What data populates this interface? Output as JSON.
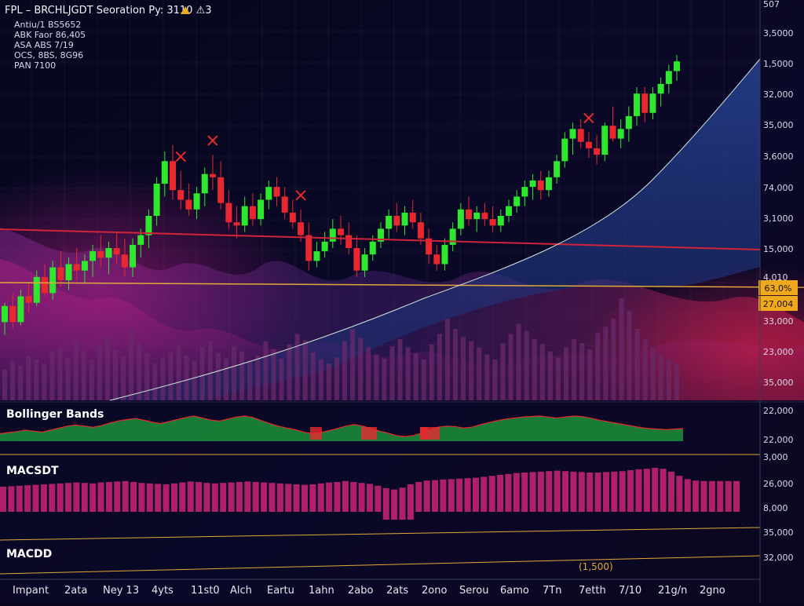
{
  "header": {
    "title": "FPL – BRCHLJGDT Seoration Py: 3110 ⚠3",
    "warning_icon": "warning-icon",
    "indicators": [
      "Antiu/1 BS5652",
      "ABK Faor 86,405",
      "ASA ABS 7/19",
      "OCS, 8BS, 8G96",
      "PAN 7100"
    ]
  },
  "colors": {
    "background": "#07061c",
    "bull": "#2ee82e",
    "bear": "#e8282e",
    "resistance": "#d0243a",
    "support": "#e0a93a",
    "trend": "#cfe8d8",
    "price_badge": "#f0a81c",
    "marker": "#e82a2a",
    "volume": "#6a2a6a",
    "bollinger": "#1a8a3a",
    "macd": "#b0206a"
  },
  "price_badges": [
    "63,0%",
    "27,004"
  ],
  "chart_data": [
    {
      "type": "candlestick",
      "panel": "price",
      "y_tick_labels": [
        "507",
        "3,5000",
        "1,5000",
        "32,000",
        "35,000",
        "3,6000",
        "74,000",
        "3,1000",
        "15,000",
        "4,010",
        "33,000",
        "23,000",
        "35,000"
      ],
      "candles": [
        {
          "o": 0.17,
          "h": 0.23,
          "l": 0.13,
          "c": 0.22
        },
        {
          "o": 0.22,
          "h": 0.26,
          "l": 0.15,
          "c": 0.17
        },
        {
          "o": 0.17,
          "h": 0.27,
          "l": 0.16,
          "c": 0.25
        },
        {
          "o": 0.25,
          "h": 0.29,
          "l": 0.2,
          "c": 0.23
        },
        {
          "o": 0.23,
          "h": 0.33,
          "l": 0.22,
          "c": 0.31
        },
        {
          "o": 0.31,
          "h": 0.35,
          "l": 0.25,
          "c": 0.26
        },
        {
          "o": 0.26,
          "h": 0.36,
          "l": 0.24,
          "c": 0.34
        },
        {
          "o": 0.34,
          "h": 0.39,
          "l": 0.28,
          "c": 0.3
        },
        {
          "o": 0.3,
          "h": 0.37,
          "l": 0.27,
          "c": 0.35
        },
        {
          "o": 0.35,
          "h": 0.4,
          "l": 0.3,
          "c": 0.33
        },
        {
          "o": 0.33,
          "h": 0.38,
          "l": 0.29,
          "c": 0.36
        },
        {
          "o": 0.36,
          "h": 0.41,
          "l": 0.31,
          "c": 0.39
        },
        {
          "o": 0.39,
          "h": 0.44,
          "l": 0.34,
          "c": 0.37
        },
        {
          "o": 0.37,
          "h": 0.42,
          "l": 0.32,
          "c": 0.4
        },
        {
          "o": 0.4,
          "h": 0.45,
          "l": 0.35,
          "c": 0.38
        },
        {
          "o": 0.38,
          "h": 0.43,
          "l": 0.31,
          "c": 0.34
        },
        {
          "o": 0.34,
          "h": 0.43,
          "l": 0.31,
          "c": 0.41
        },
        {
          "o": 0.41,
          "h": 0.46,
          "l": 0.37,
          "c": 0.44
        },
        {
          "o": 0.44,
          "h": 0.52,
          "l": 0.4,
          "c": 0.5
        },
        {
          "o": 0.5,
          "h": 0.62,
          "l": 0.47,
          "c": 0.6
        },
        {
          "o": 0.6,
          "h": 0.7,
          "l": 0.56,
          "c": 0.67
        },
        {
          "o": 0.67,
          "h": 0.72,
          "l": 0.55,
          "c": 0.58
        },
        {
          "o": 0.58,
          "h": 0.64,
          "l": 0.52,
          "c": 0.55
        },
        {
          "o": 0.55,
          "h": 0.6,
          "l": 0.5,
          "c": 0.52
        },
        {
          "o": 0.52,
          "h": 0.59,
          "l": 0.49,
          "c": 0.57
        },
        {
          "o": 0.57,
          "h": 0.65,
          "l": 0.53,
          "c": 0.63
        },
        {
          "o": 0.63,
          "h": 0.69,
          "l": 0.58,
          "c": 0.62
        },
        {
          "o": 0.62,
          "h": 0.67,
          "l": 0.52,
          "c": 0.54
        },
        {
          "o": 0.54,
          "h": 0.58,
          "l": 0.46,
          "c": 0.48
        },
        {
          "o": 0.48,
          "h": 0.53,
          "l": 0.43,
          "c": 0.47
        },
        {
          "o": 0.47,
          "h": 0.56,
          "l": 0.45,
          "c": 0.53
        },
        {
          "o": 0.53,
          "h": 0.57,
          "l": 0.47,
          "c": 0.49
        },
        {
          "o": 0.49,
          "h": 0.57,
          "l": 0.47,
          "c": 0.55
        },
        {
          "o": 0.55,
          "h": 0.61,
          "l": 0.52,
          "c": 0.59
        },
        {
          "o": 0.59,
          "h": 0.62,
          "l": 0.53,
          "c": 0.56
        },
        {
          "o": 0.56,
          "h": 0.59,
          "l": 0.49,
          "c": 0.51
        },
        {
          "o": 0.51,
          "h": 0.55,
          "l": 0.46,
          "c": 0.48
        },
        {
          "o": 0.48,
          "h": 0.52,
          "l": 0.42,
          "c": 0.44
        },
        {
          "o": 0.44,
          "h": 0.48,
          "l": 0.33,
          "c": 0.36
        },
        {
          "o": 0.36,
          "h": 0.42,
          "l": 0.34,
          "c": 0.39
        },
        {
          "o": 0.39,
          "h": 0.45,
          "l": 0.37,
          "c": 0.42
        },
        {
          "o": 0.42,
          "h": 0.49,
          "l": 0.4,
          "c": 0.46
        },
        {
          "o": 0.46,
          "h": 0.5,
          "l": 0.41,
          "c": 0.44
        },
        {
          "o": 0.44,
          "h": 0.48,
          "l": 0.38,
          "c": 0.4
        },
        {
          "o": 0.4,
          "h": 0.44,
          "l": 0.31,
          "c": 0.33
        },
        {
          "o": 0.33,
          "h": 0.4,
          "l": 0.31,
          "c": 0.38
        },
        {
          "o": 0.38,
          "h": 0.44,
          "l": 0.36,
          "c": 0.42
        },
        {
          "o": 0.42,
          "h": 0.48,
          "l": 0.4,
          "c": 0.46
        },
        {
          "o": 0.46,
          "h": 0.52,
          "l": 0.43,
          "c": 0.5
        },
        {
          "o": 0.5,
          "h": 0.54,
          "l": 0.45,
          "c": 0.47
        },
        {
          "o": 0.47,
          "h": 0.53,
          "l": 0.44,
          "c": 0.51
        },
        {
          "o": 0.51,
          "h": 0.55,
          "l": 0.46,
          "c": 0.48
        },
        {
          "o": 0.48,
          "h": 0.51,
          "l": 0.41,
          "c": 0.43
        },
        {
          "o": 0.43,
          "h": 0.46,
          "l": 0.35,
          "c": 0.38
        },
        {
          "o": 0.38,
          "h": 0.41,
          "l": 0.33,
          "c": 0.35
        },
        {
          "o": 0.35,
          "h": 0.43,
          "l": 0.33,
          "c": 0.41
        },
        {
          "o": 0.41,
          "h": 0.48,
          "l": 0.39,
          "c": 0.46
        },
        {
          "o": 0.46,
          "h": 0.54,
          "l": 0.44,
          "c": 0.52
        },
        {
          "o": 0.52,
          "h": 0.56,
          "l": 0.47,
          "c": 0.49
        },
        {
          "o": 0.49,
          "h": 0.53,
          "l": 0.45,
          "c": 0.51
        },
        {
          "o": 0.51,
          "h": 0.54,
          "l": 0.47,
          "c": 0.49
        },
        {
          "o": 0.49,
          "h": 0.53,
          "l": 0.45,
          "c": 0.47
        },
        {
          "o": 0.47,
          "h": 0.52,
          "l": 0.45,
          "c": 0.5
        },
        {
          "o": 0.5,
          "h": 0.55,
          "l": 0.48,
          "c": 0.53
        },
        {
          "o": 0.53,
          "h": 0.58,
          "l": 0.51,
          "c": 0.56
        },
        {
          "o": 0.56,
          "h": 0.61,
          "l": 0.53,
          "c": 0.59
        },
        {
          "o": 0.59,
          "h": 0.63,
          "l": 0.55,
          "c": 0.61
        },
        {
          "o": 0.61,
          "h": 0.64,
          "l": 0.55,
          "c": 0.58
        },
        {
          "o": 0.58,
          "h": 0.64,
          "l": 0.56,
          "c": 0.62
        },
        {
          "o": 0.62,
          "h": 0.69,
          "l": 0.6,
          "c": 0.67
        },
        {
          "o": 0.67,
          "h": 0.76,
          "l": 0.65,
          "c": 0.74
        },
        {
          "o": 0.74,
          "h": 0.79,
          "l": 0.69,
          "c": 0.77
        },
        {
          "o": 0.77,
          "h": 0.8,
          "l": 0.71,
          "c": 0.73
        },
        {
          "o": 0.73,
          "h": 0.76,
          "l": 0.68,
          "c": 0.71
        },
        {
          "o": 0.71,
          "h": 0.75,
          "l": 0.66,
          "c": 0.69
        },
        {
          "o": 0.69,
          "h": 0.79,
          "l": 0.67,
          "c": 0.78
        },
        {
          "o": 0.78,
          "h": 0.84,
          "l": 0.73,
          "c": 0.74
        },
        {
          "o": 0.74,
          "h": 0.8,
          "l": 0.71,
          "c": 0.77
        },
        {
          "o": 0.77,
          "h": 0.84,
          "l": 0.73,
          "c": 0.81
        },
        {
          "o": 0.81,
          "h": 0.9,
          "l": 0.78,
          "c": 0.88
        },
        {
          "o": 0.88,
          "h": 0.9,
          "l": 0.79,
          "c": 0.82
        },
        {
          "o": 0.82,
          "h": 0.9,
          "l": 0.8,
          "c": 0.88
        },
        {
          "o": 0.88,
          "h": 0.93,
          "l": 0.84,
          "c": 0.91
        },
        {
          "o": 0.91,
          "h": 0.97,
          "l": 0.88,
          "c": 0.95
        },
        {
          "o": 0.95,
          "h": 1.0,
          "l": 0.92,
          "c": 0.98
        }
      ],
      "sell_markers_at_candle": [
        22,
        26,
        37,
        73
      ],
      "resistance_level": 0.51,
      "support_level": 0.36
    },
    {
      "type": "bar",
      "panel": "volume",
      "values": [
        0.3,
        0.38,
        0.34,
        0.44,
        0.4,
        0.36,
        0.48,
        0.52,
        0.42,
        0.58,
        0.47,
        0.4,
        0.53,
        0.61,
        0.5,
        0.43,
        0.69,
        0.56,
        0.46,
        0.36,
        0.41,
        0.47,
        0.53,
        0.44,
        0.39,
        0.52,
        0.58,
        0.46,
        0.41,
        0.53,
        0.48,
        0.39,
        0.44,
        0.58,
        0.5,
        0.41,
        0.55,
        0.65,
        0.59,
        0.47,
        0.4,
        0.36,
        0.42,
        0.58,
        0.7,
        0.61,
        0.52,
        0.45,
        0.41,
        0.53,
        0.6,
        0.52,
        0.46,
        0.4,
        0.55,
        0.65,
        0.8,
        0.7,
        0.62,
        0.58,
        0.52,
        0.45,
        0.4,
        0.56,
        0.65,
        0.75,
        0.68,
        0.6,
        0.55,
        0.48,
        0.42,
        0.52,
        0.6,
        0.56,
        0.5,
        0.66,
        0.72,
        0.8,
        1.0,
        0.88,
        0.7,
        0.6,
        0.52,
        0.45,
        0.4,
        0.36
      ]
    },
    {
      "type": "area",
      "panel": "bollinger",
      "title": "Bollinger Bands",
      "y_tick_labels": [
        "22,000",
        "22,000"
      ],
      "values": [
        0.3,
        0.34,
        0.38,
        0.44,
        0.4,
        0.36,
        0.44,
        0.52,
        0.6,
        0.64,
        0.6,
        0.55,
        0.62,
        0.72,
        0.8,
        0.86,
        0.9,
        0.84,
        0.76,
        0.7,
        0.78,
        0.86,
        0.94,
        1.0,
        0.92,
        0.84,
        0.8,
        0.88,
        0.96,
        1.0,
        0.94,
        0.82,
        0.7,
        0.6,
        0.52,
        0.46,
        0.36,
        0.3,
        0.34,
        0.42,
        0.5,
        0.6,
        0.66,
        0.6,
        0.5,
        0.4,
        0.32,
        0.22,
        0.18,
        0.22,
        0.32,
        0.46,
        0.56,
        0.6,
        0.58,
        0.52,
        0.56,
        0.66,
        0.74,
        0.82,
        0.88,
        0.92,
        0.96,
        0.98,
        1.0,
        0.96,
        0.92,
        0.96,
        1.0,
        0.98,
        0.92,
        0.84,
        0.78,
        0.72,
        0.66,
        0.6,
        0.54,
        0.5,
        0.48,
        0.46,
        0.48,
        0.5
      ]
    },
    {
      "type": "bar",
      "panel": "macd",
      "title": "MACSDT",
      "y_tick_labels": [
        "26,000",
        "8,000"
      ],
      "values": [
        0.2,
        0.22,
        0.24,
        0.26,
        0.28,
        0.3,
        0.32,
        0.34,
        0.36,
        0.38,
        0.36,
        0.34,
        0.38,
        0.4,
        0.42,
        0.44,
        0.4,
        0.36,
        0.34,
        0.32,
        0.3,
        0.34,
        0.38,
        0.42,
        0.4,
        0.36,
        0.34,
        0.36,
        0.38,
        0.4,
        0.42,
        0.4,
        0.38,
        0.36,
        0.34,
        0.32,
        0.3,
        0.28,
        0.3,
        0.34,
        0.38,
        0.4,
        0.44,
        0.4,
        0.36,
        0.32,
        0.24,
        0.14,
        0.08,
        0.16,
        0.3,
        0.4,
        0.46,
        0.48,
        0.5,
        0.52,
        0.54,
        0.56,
        0.58,
        0.62,
        0.66,
        0.7,
        0.74,
        0.78,
        0.8,
        0.82,
        0.84,
        0.86,
        0.88,
        0.86,
        0.84,
        0.82,
        0.8,
        0.8,
        0.82,
        0.84,
        0.86,
        0.9,
        0.94,
        0.96,
        1.0,
        0.96,
        0.84,
        0.66,
        0.52,
        0.46,
        0.44,
        0.44,
        0.44,
        0.44,
        0.44
      ]
    },
    {
      "type": "line",
      "panel": "macd-signal",
      "title": "MACDD",
      "y_tick_labels": [
        "35,000",
        "32,000"
      ],
      "value_label": "(1,500)"
    }
  ],
  "axis": {
    "right_labels": [
      "507",
      "3,5000",
      "1,5000",
      "32,000",
      "35,000",
      "3,6000",
      "74,000",
      "3,1000",
      "15,000",
      "4,010",
      "33,000",
      "23,000",
      "35,000",
      "22,000",
      "22,000",
      "3,000",
      "26,000",
      "8,000",
      "35,000",
      "32,000"
    ],
    "x_labels": [
      "Impant",
      "2ata",
      "Ney 13",
      "4yts",
      "11st0",
      "Alch",
      "Eartu",
      "1ahn",
      "2abo",
      "2ats",
      "2ono",
      "Serou",
      "6amo",
      "7Tn",
      "7etth",
      "7/10",
      "21g/n",
      "2gno"
    ]
  }
}
